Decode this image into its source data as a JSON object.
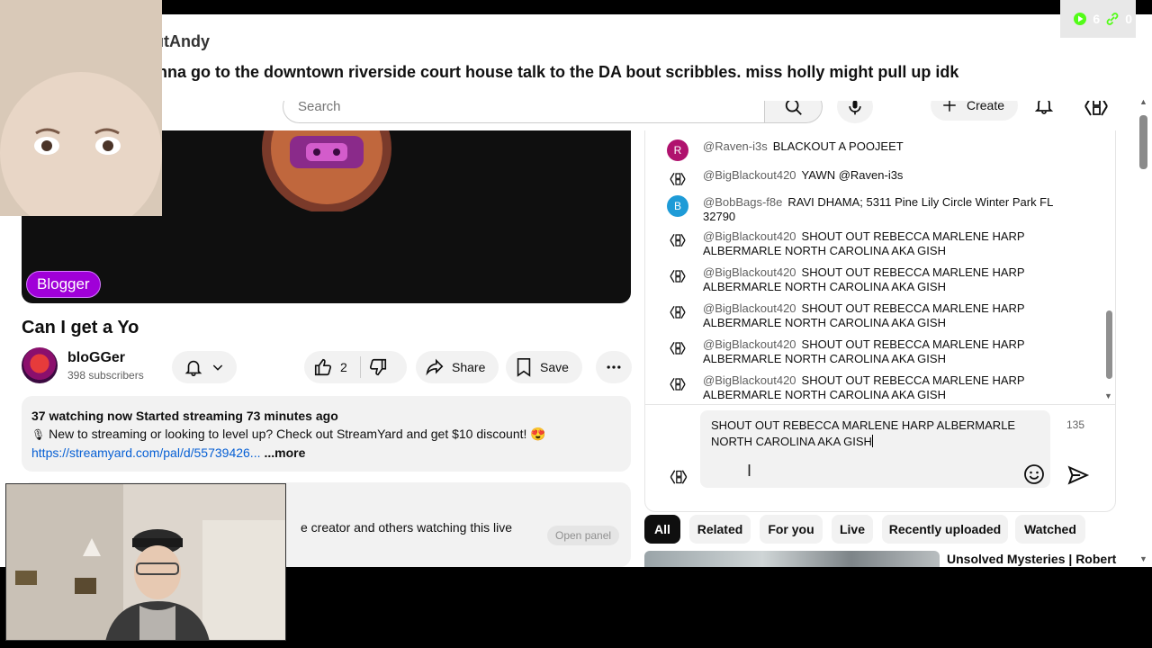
{
  "overlay": {
    "username": "BlackoutAndy",
    "message": "i am gonna go to the downtown riverside court house talk to the DA bout scribbles. miss holly might pull up idk",
    "stats": {
      "viewers": "6",
      "links": "0"
    }
  },
  "header": {
    "search_placeholder": "Search",
    "create_label": "Create"
  },
  "video": {
    "badge": "Blogger",
    "title": "Can I get a Yo",
    "channel_name": "bloGGer",
    "subscribers": "398 subscribers",
    "likes": "2",
    "share_label": "Share",
    "save_label": "Save"
  },
  "description": {
    "status": "37 watching now  Started streaming 73 minutes ago",
    "text": "New to streaming or looking to level up? Check out StreamYard and get $10 discount! 😍",
    "link": "https://streamyard.com/pal/d/55739426...",
    "more": "...more"
  },
  "chat_card": {
    "text": "e creator and others watching this live",
    "open_panel": "Open panel"
  },
  "chat": {
    "messages": [
      {
        "avatar": "R",
        "avatar_color": "#b0126e",
        "author": "@Raven-i3s",
        "text": "BLACKOUT A POOJEET"
      },
      {
        "avatar": "",
        "avatar_color": "",
        "author": "@BigBlackout420",
        "text": "YAWN @Raven-i3s"
      },
      {
        "avatar": "B",
        "avatar_color": "#1e9bd7",
        "author": "@BobBags-f8e",
        "text": "RAVI DHAMA; 5311 Pine Lily Circle Winter Park FL 32790"
      },
      {
        "avatar": "",
        "avatar_color": "",
        "author": "@BigBlackout420",
        "text": "SHOUT OUT REBECCA MARLENE HARP ALBERMARLE NORTH CAROLINA AKA GISH"
      },
      {
        "avatar": "",
        "avatar_color": "",
        "author": "@BigBlackout420",
        "text": "SHOUT OUT REBECCA MARLENE HARP ALBERMARLE NORTH CAROLINA AKA GISH"
      },
      {
        "avatar": "",
        "avatar_color": "",
        "author": "@BigBlackout420",
        "text": "SHOUT OUT REBECCA MARLENE HARP ALBERMARLE NORTH CAROLINA AKA GISH"
      },
      {
        "avatar": "",
        "avatar_color": "",
        "author": "@BigBlackout420",
        "text": "SHOUT OUT REBECCA MARLENE HARP ALBERMARLE NORTH CAROLINA AKA GISH"
      },
      {
        "avatar": "",
        "avatar_color": "",
        "author": "@BigBlackout420",
        "text": "SHOUT OUT REBECCA MARLENE HARP ALBERMARLE NORTH CAROLINA AKA GISH"
      }
    ],
    "input_value": "SHOUT OUT REBECCA MARLENE HARP ALBERMARLE NORTH CAROLINA AKA GISH",
    "char_count": "135"
  },
  "chips": [
    "All",
    "Related",
    "For you",
    "Live",
    "Recently uploaded",
    "Watched"
  ],
  "recommendation": {
    "title": "Unsolved Mysteries | Robert"
  },
  "colors": {
    "accent_chip": "#0f0f0f",
    "badge": "#a000d8",
    "link": "#065fd4",
    "overlay_logo_bg": "#000000",
    "overlay_logo_fg": "#53fc18"
  }
}
